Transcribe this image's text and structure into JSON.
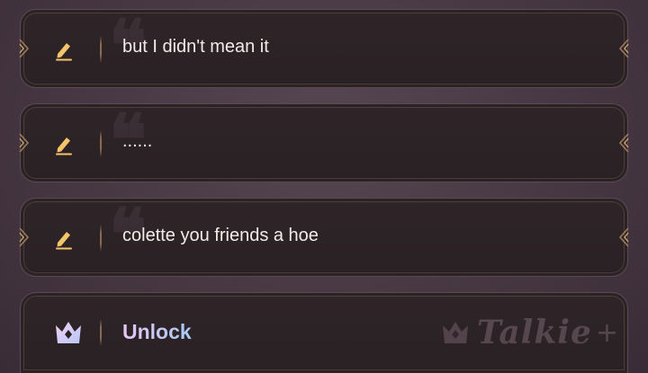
{
  "messages": [
    {
      "text": "but I didn't mean it"
    },
    {
      "text": "......"
    },
    {
      "text": "colette you friends a hoe"
    }
  ],
  "unlock": {
    "label": "Unlock"
  },
  "watermark": {
    "brand": "Talkie",
    "suffix": "+"
  },
  "icons": {
    "edit": "pencil-edit-icon",
    "crown": "crown-icon",
    "quote": "quote-mark-icon"
  },
  "colors": {
    "accent_gold": "#f3c46a",
    "text": "#f2ece8",
    "unlock_gradient_start": "#e6c6f3",
    "unlock_gradient_end": "#a8c8f4"
  }
}
